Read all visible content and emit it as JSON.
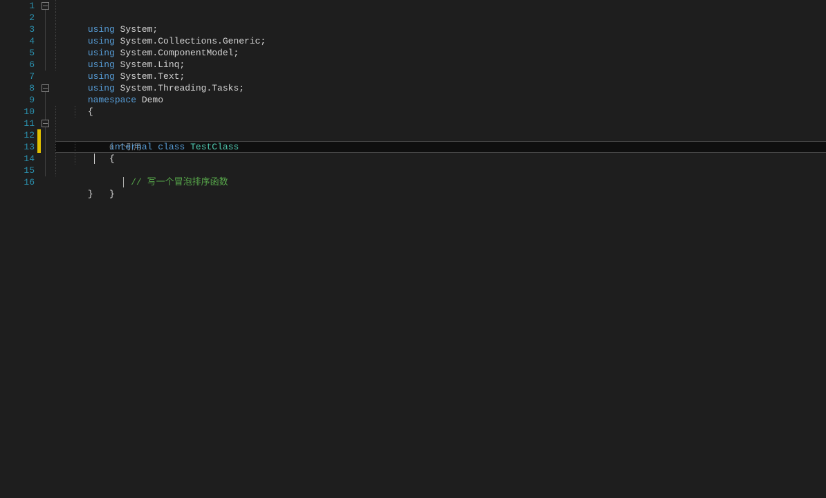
{
  "lineNumbers": [
    "1",
    "2",
    "3",
    "4",
    "5",
    "6",
    "7",
    "8",
    "9",
    "10",
    "11",
    "12",
    "13",
    "14",
    "15",
    "16"
  ],
  "code": {
    "l1": {
      "kw": "using",
      "rest": " System;"
    },
    "l2": {
      "kw": "using",
      "rest": " System.Collections.Generic;"
    },
    "l3": {
      "kw": "using",
      "rest": " System.ComponentModel;"
    },
    "l4": {
      "kw": "using",
      "rest": " System.Linq;"
    },
    "l5": {
      "kw": "using",
      "rest": " System.Text;"
    },
    "l6": {
      "kw": "using",
      "rest": " System.Threading.Tasks;"
    },
    "l8": {
      "kw": "namespace",
      "name": " Demo"
    },
    "l9": {
      "brace": "{"
    },
    "codelens": "0 个引用",
    "l10": {
      "mod": "internal",
      "kw": "class",
      "name": "TestClass"
    },
    "l11": {
      "brace": "{"
    },
    "l12": {
      "comment": "// 写一个冒泡排序函数"
    },
    "l14": {
      "brace": "}"
    },
    "l15": {
      "brace": "}"
    }
  },
  "currentLine": 13,
  "changeMark": {
    "startLine": 12,
    "endLine": 13
  }
}
